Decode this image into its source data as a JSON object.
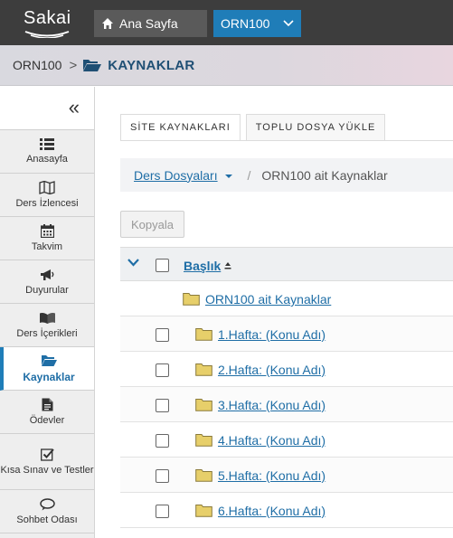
{
  "header": {
    "logo_text": "Sakai",
    "home_label": "Ana Sayfa",
    "site_label": "ORN100"
  },
  "breadcrumb": {
    "site": "ORN100",
    "separator": ">",
    "tool": "KAYNAKLAR"
  },
  "sidebar": {
    "collapse_glyph": "«",
    "items": [
      {
        "label": "Anasayfa",
        "icon": "list-icon"
      },
      {
        "label": "Ders İzlencesi",
        "icon": "map-icon"
      },
      {
        "label": "Takvim",
        "icon": "calendar-icon"
      },
      {
        "label": "Duyurular",
        "icon": "megaphone-icon"
      },
      {
        "label": "Ders İçerikleri",
        "icon": "book-icon"
      },
      {
        "label": "Kaynaklar",
        "icon": "folder-open-icon",
        "active": true
      },
      {
        "label": "Ödevler",
        "icon": "document-icon"
      },
      {
        "label": "Kısa Sınav ve Testler",
        "icon": "check-square-icon"
      },
      {
        "label": "Sohbet Odası",
        "icon": "chat-icon"
      }
    ]
  },
  "main": {
    "tabs": [
      "SİTE KAYNAKLARI",
      "TOPLU DOSYA YÜKLE"
    ],
    "path": {
      "dropdown": "Ders Dosyaları",
      "separator": "/",
      "current": "ORN100 ait Kaynaklar"
    },
    "copy_button": "Kopyala",
    "table": {
      "header_title": "Başlık",
      "root_folder": "ORN100 ait Kaynaklar",
      "folders": [
        "1.Hafta: (Konu Adı)",
        "2.Hafta: (Konu Adı)",
        "3.Hafta: (Konu Adı)",
        "4.Hafta: (Konu Adı)",
        "5.Hafta: (Konu Adı)",
        "6.Hafta: (Konu Adı)"
      ]
    }
  },
  "colors": {
    "topbar": "#3d3d3d",
    "accent": "#1f7db8",
    "link": "#1f6ea6",
    "folder": "#e7cf6a"
  }
}
